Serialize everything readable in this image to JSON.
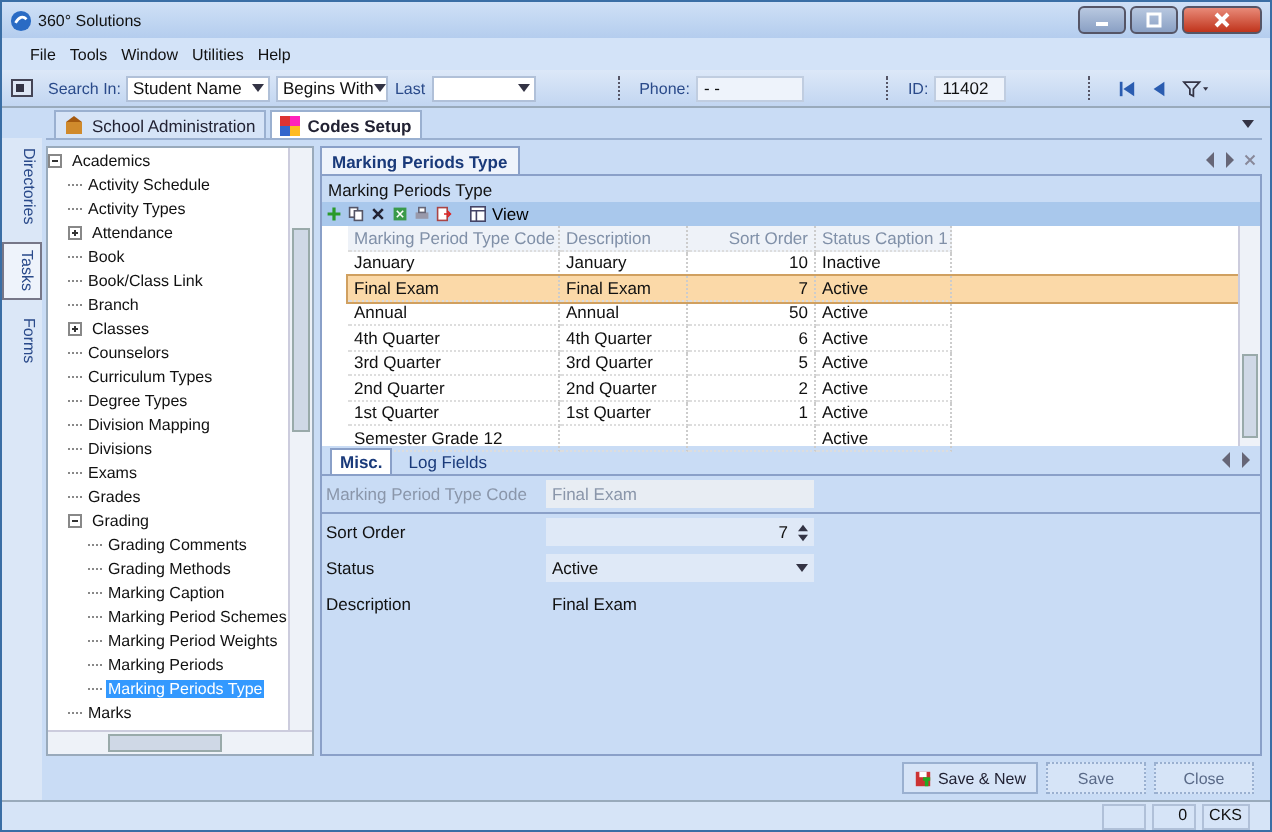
{
  "window": {
    "title": "360° Solutions"
  },
  "menu": [
    "File",
    "Tools",
    "Window",
    "Utilities",
    "Help"
  ],
  "toolbar": {
    "search_in_label": "Search In:",
    "search_in": "Student Name",
    "match": "Begins With",
    "last_label": "Last",
    "phone_label": "Phone:",
    "phone": "- -",
    "id_label": "ID:",
    "id": "11402"
  },
  "module_tabs": [
    {
      "label": "School Administration",
      "selected": false
    },
    {
      "label": "Codes Setup",
      "selected": true
    }
  ],
  "side_tabs": [
    {
      "label": "Directories",
      "selected": false
    },
    {
      "label": "Tasks",
      "selected": true
    },
    {
      "label": "Forms",
      "selected": false
    }
  ],
  "tree": [
    {
      "label": "Academics",
      "selected": false,
      "expanded": true,
      "children": [
        {
          "label": "Activity Schedule",
          "selected": false
        },
        {
          "label": "Activity Types",
          "selected": false
        },
        {
          "label": "Attendance",
          "selected": false,
          "expanded": false
        },
        {
          "label": "Book",
          "selected": false
        },
        {
          "label": "Book/Class Link",
          "selected": false
        },
        {
          "label": "Branch",
          "selected": false
        },
        {
          "label": "Classes",
          "selected": false,
          "expanded": false
        },
        {
          "label": "Counselors",
          "selected": false
        },
        {
          "label": "Curriculum Types",
          "selected": false
        },
        {
          "label": "Degree Types",
          "selected": false
        },
        {
          "label": "Division Mapping",
          "selected": false
        },
        {
          "label": "Divisions",
          "selected": false
        },
        {
          "label": "Exams",
          "selected": false
        },
        {
          "label": "Grades",
          "selected": false
        },
        {
          "label": "Grading",
          "selected": false,
          "expanded": true,
          "children": [
            {
              "label": "Grading Comments",
              "selected": false
            },
            {
              "label": "Grading Methods",
              "selected": false
            },
            {
              "label": "Marking Caption",
              "selected": false
            },
            {
              "label": "Marking Period Schemes",
              "selected": false
            },
            {
              "label": "Marking Period Weights",
              "selected": false
            },
            {
              "label": "Marking Periods",
              "selected": false
            },
            {
              "label": "Marking Periods Type",
              "selected": true
            }
          ]
        },
        {
          "label": "Marks",
          "selected": false
        }
      ]
    }
  ],
  "doc_tab": {
    "label": "Marking Periods Type"
  },
  "panel_title": "Marking Periods Type",
  "grid_toolbar": {
    "view": "View"
  },
  "table": {
    "columns": [
      "Marking Period Type Code",
      "Description",
      "Sort Order",
      "Status Caption 1"
    ],
    "rows": [
      {
        "cells": [
          "January",
          "January",
          "10",
          "Inactive"
        ],
        "selected": false
      },
      {
        "cells": [
          "Final Exam",
          "Final Exam",
          "7",
          "Active"
        ],
        "selected": true
      },
      {
        "cells": [
          "Annual",
          "Annual",
          "50",
          "Active"
        ],
        "selected": false
      },
      {
        "cells": [
          "4th Quarter",
          "4th Quarter",
          "6",
          "Active"
        ],
        "selected": false
      },
      {
        "cells": [
          "3rd Quarter",
          "3rd Quarter",
          "5",
          "Active"
        ],
        "selected": false
      },
      {
        "cells": [
          "2nd Quarter",
          "2nd Quarter",
          "2",
          "Active"
        ],
        "selected": false
      },
      {
        "cells": [
          "1st Quarter",
          "1st Quarter",
          "1",
          "Active"
        ],
        "selected": false
      },
      {
        "cells": [
          "Semester Grade 12",
          "",
          "",
          "Active"
        ],
        "selected": false
      }
    ]
  },
  "detail_tabs": [
    {
      "label": "Misc.",
      "selected": true
    },
    {
      "label": "Log Fields",
      "selected": false
    }
  ],
  "form": [
    {
      "kind": "text",
      "label": "Marking Period Type Code",
      "value": "Final Exam",
      "disabled": true
    },
    {
      "kind": "spin",
      "label": "Sort Order",
      "value": "7",
      "disabled": false
    },
    {
      "kind": "select",
      "label": "Status",
      "value": "Active",
      "disabled": false
    },
    {
      "kind": "plain",
      "label": "Description",
      "value": "Final Exam",
      "disabled": false
    }
  ],
  "buttons": [
    {
      "label": "Save & New",
      "disabled": false
    },
    {
      "label": "Save",
      "disabled": true
    },
    {
      "label": "Close",
      "disabled": true
    }
  ],
  "status_bar": [
    "0",
    "CKS"
  ]
}
